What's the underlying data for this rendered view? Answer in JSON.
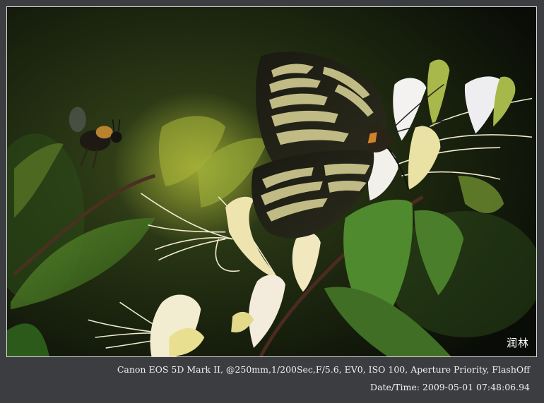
{
  "photo": {
    "subject": "butterfly-bee-honeysuckle",
    "watermark": "润林"
  },
  "caption": {
    "camera_line": "Canon EOS 5D Mark II,  @250mm,1/200Sec,F/5.6, EV0, ISO 100, Aperture Priority, FlashOff",
    "datetime_line": "Date/Time: 2009-05-01 07:48:06.94"
  },
  "colors": {
    "frame": "#3b3d40",
    "photo_border": "#d9d9d9",
    "caption_text": "#f2f2f2"
  }
}
